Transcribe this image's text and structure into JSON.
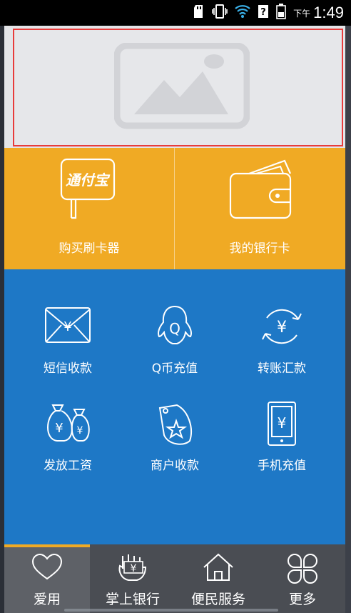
{
  "status_bar": {
    "ampm": "下午",
    "time": "1:49"
  },
  "banner": {
    "icon": "image-placeholder-icon"
  },
  "top_tiles": [
    {
      "label": "购买刷卡器",
      "icon": "card-reader-icon",
      "badge_text": "通付宝"
    },
    {
      "label": "我的银行卡",
      "icon": "wallet-icon"
    }
  ],
  "services": [
    {
      "label": "短信收款",
      "icon": "sms-envelope-yuan-icon"
    },
    {
      "label": "Q币充值",
      "icon": "qq-penguin-icon"
    },
    {
      "label": "转账汇款",
      "icon": "transfer-yuan-icon"
    },
    {
      "label": "发放工资",
      "icon": "money-bags-icon"
    },
    {
      "label": "商户收款",
      "icon": "merchant-tag-icon"
    },
    {
      "label": "手机充值",
      "icon": "phone-yuan-icon"
    }
  ],
  "bottom_nav": [
    {
      "label": "爱用",
      "icon": "heart-icon",
      "active": true
    },
    {
      "label": "掌上银行",
      "icon": "hand-yuan-icon",
      "active": false
    },
    {
      "label": "便民服务",
      "icon": "home-icon",
      "active": false
    },
    {
      "label": "更多",
      "icon": "clover-icon",
      "active": false
    }
  ],
  "colors": {
    "yellow": "#f0aa24",
    "blue": "#1e78c6",
    "nav_bg": "#4a4d53",
    "highlight_border": "#e83b3b"
  }
}
